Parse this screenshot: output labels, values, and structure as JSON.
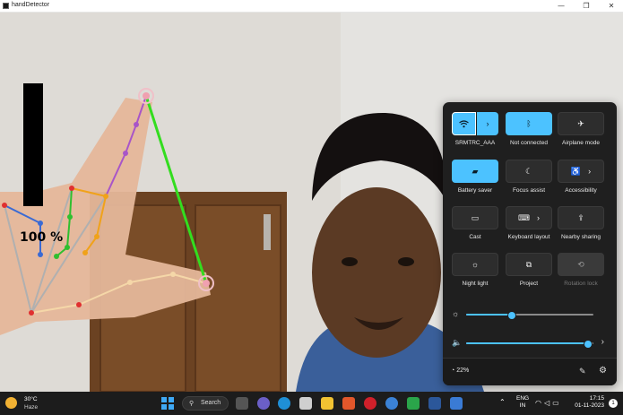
{
  "window": {
    "title": "handDetector"
  },
  "overlay": {
    "volume_percent_text": "100 %",
    "volume_level": 1.0
  },
  "quick_settings": {
    "tiles": [
      {
        "label": "SRMTRC_AAA",
        "icon": "wifi-icon",
        "state": "on",
        "split": true
      },
      {
        "label": "Not connected",
        "icon": "bluetooth-icon",
        "state": "on"
      },
      {
        "label": "Airplane mode",
        "icon": "airplane-icon",
        "state": "off"
      },
      {
        "label": "Battery saver",
        "icon": "battery-saver-icon",
        "state": "on"
      },
      {
        "label": "Focus assist",
        "icon": "moon-icon",
        "state": "off"
      },
      {
        "label": "Accessibility",
        "icon": "accessibility-icon",
        "state": "off",
        "chevron": true
      },
      {
        "label": "Cast",
        "icon": "cast-icon",
        "state": "off"
      },
      {
        "label": "Keyboard layout",
        "icon": "keyboard-icon",
        "state": "off",
        "chevron": true
      },
      {
        "label": "Nearby sharing",
        "icon": "share-icon",
        "state": "off"
      },
      {
        "label": "Night light",
        "icon": "sun-icon",
        "state": "off"
      },
      {
        "label": "Project",
        "icon": "project-icon",
        "state": "off"
      },
      {
        "label": "Rotation lock",
        "icon": "rotation-icon",
        "state": "disabled"
      }
    ],
    "brightness_level": 0.36,
    "volume_level": 0.96,
    "battery_text": "22%",
    "accent_color": "#4cc2ff"
  },
  "taskbar": {
    "weather_temp": "30°C",
    "weather_condition": "Haze",
    "search_label": "Search",
    "lang_line1": "ENG",
    "lang_line2": "IN",
    "time": "17:15",
    "date": "01-11-2023",
    "notification_count": "1"
  }
}
